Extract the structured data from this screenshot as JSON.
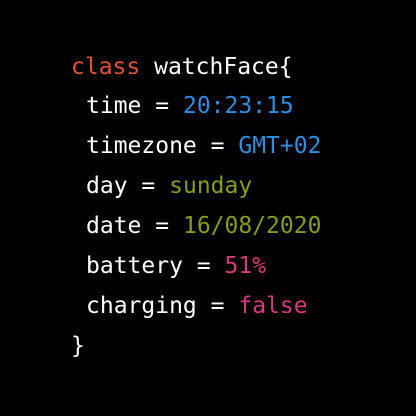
{
  "colors": {
    "background": "#000000",
    "text": "#ffffff",
    "keyword": "#e0523a",
    "blue": "#2f8fdf",
    "green": "#8a9a1e",
    "pink": "#d6397e"
  },
  "header": {
    "keyword": "class",
    "class_name": "watchFace",
    "open_brace": "{"
  },
  "fields": [
    {
      "name": "time",
      "equals": "=",
      "value": "20:23:15"
    },
    {
      "name": "timezone",
      "equals": "=",
      "value": "GMT+02"
    },
    {
      "name": "day",
      "equals": "=",
      "value": "sunday"
    },
    {
      "name": "date",
      "equals": "=",
      "value": "16/08/2020"
    },
    {
      "name": "battery",
      "equals": "=",
      "value": "51%"
    },
    {
      "name": "charging",
      "equals": "=",
      "value": "false"
    }
  ],
  "footer": {
    "close_brace": "}"
  }
}
